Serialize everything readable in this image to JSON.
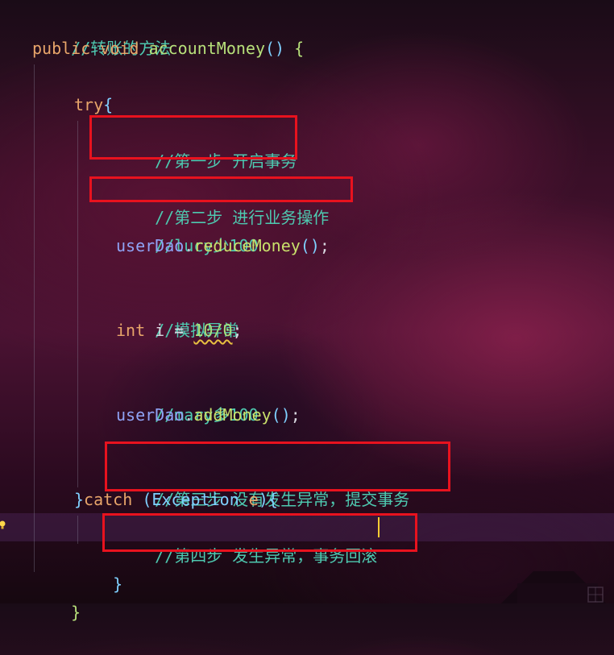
{
  "code": {
    "l1_comment": "//转账的方法",
    "l2_public": "public",
    "l2_void": "void",
    "l2_name": "accountMoney",
    "l2_paren": "()",
    "l2_brace": "{",
    "l4_try": "try",
    "l4_brace": "{",
    "l5_comment": "//第一步 开启事务",
    "l7_comment": "//第二步 进行业务操作",
    "l8_comment": "//lucy少100",
    "l9_obj": "userDao",
    "l9_dot": ".",
    "l9_method": "reduceMoney",
    "l9_paren": "()",
    "l9_semi": ";",
    "l11_comment": "//模拟异常",
    "l12_type": "int",
    "l12_var": "i",
    "l12_eq": "=",
    "l12_expr": "10/0",
    "l12_semi": ";",
    "l14_comment": "//mary多100",
    "l15_obj": "userDao",
    "l15_dot": ".",
    "l15_method": "addMoney",
    "l15_paren": "()",
    "l15_semi": ";",
    "l17_comment": "//第三步 没有发生异常，提交事务",
    "l18_close": "}",
    "l18_catch": "catch",
    "l18_open": "(",
    "l18_type": "Exception",
    "l18_var": "e",
    "l18_close2": "){",
    "l19_comment": "//第四步 发生异常，事务回滚",
    "l20_brace": "}",
    "l21_brace": "}"
  },
  "colors": {
    "highlight_box": "#e8121e",
    "comment": "#4ec9b0",
    "keyword": "#e8a56a"
  },
  "icons": {
    "gutter": "lightbulb-icon"
  }
}
